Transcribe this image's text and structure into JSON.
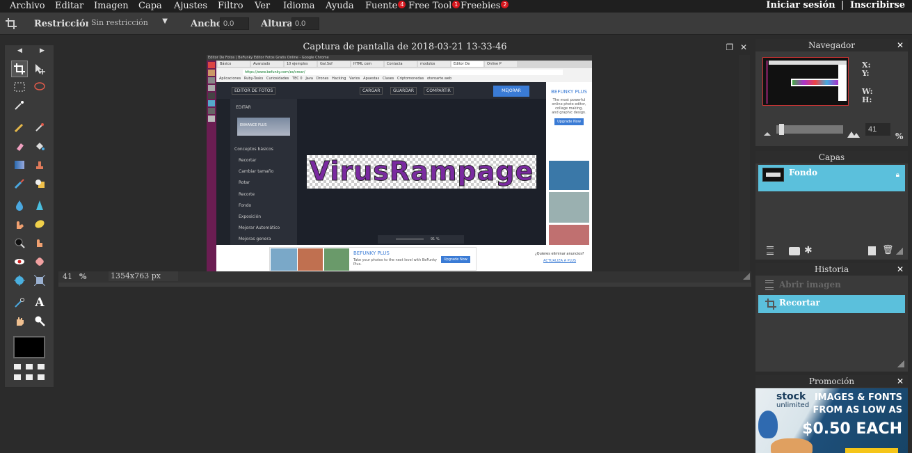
{
  "menubar": {
    "items": [
      "Archivo",
      "Editar",
      "Imagen",
      "Capa",
      "Ajustes",
      "Filtro",
      "Ver",
      "Idioma",
      "Ayuda"
    ],
    "extras": [
      {
        "label": "Fuente",
        "badge": "4"
      },
      {
        "label": "Free Tool",
        "badge": "1"
      },
      {
        "label": "Freebies",
        "badge": "2"
      }
    ],
    "login": "Iniciar sesión",
    "separator": "|",
    "signup": "Inscribirse"
  },
  "options": {
    "restriction_label": "Restricción:",
    "restriction_value": "Sin restricción",
    "width_label": "Ancho:",
    "width_value": "0.0",
    "height_label": "Altura:",
    "height_value": "0.0"
  },
  "document": {
    "title": "Captura de pantalla de 2018-03-21 13-33-46",
    "zoom": "41",
    "zoom_unit": "%",
    "dimensions": "1354x763 px",
    "inner": {
      "browser_title": "Editor De Fotos | BeFunky Editor Fotos Gratis Online - Google Chrome",
      "tabs": [
        "Básico",
        "Avanzado",
        "10 ejemplos",
        "Gal.Sof",
        "HTML com",
        "Contacta",
        "modulos",
        "Editor De",
        "Online P"
      ],
      "address": "https://www.befunky.com/es/crear/",
      "bookmarks": [
        "Aplicaciones",
        "Ruby-Tasks",
        "Curiosidades",
        "TEC 0",
        "Java",
        "Drones",
        "Hacking",
        "Varios",
        "Apuestas",
        "Clases",
        "Criptomonedas",
        "oteroarte.web"
      ],
      "editor_menu": "EDITOR DE FOTOS",
      "top_buttons": [
        "CARGAR",
        "GUARDAR",
        "COMPARTIR"
      ],
      "upgrade": "MEJORAR",
      "side_title": "EDITAR",
      "enhance": "ENHANCE PLUS",
      "section": "Conceptos básicos",
      "side_items": [
        "Recortar",
        "Cambiar tamaño",
        "Rotar",
        "Recorte",
        "Fondo",
        "Exposición",
        "Mejorar Automático",
        "Mejoras genera"
      ],
      "banner_text": "VirusRampage",
      "ad_title": "BEFUNKY PLUS",
      "ad_body": "The most powerful online photo editor, collage making, and graphic design.",
      "ad_button": "Upgrade Now",
      "bottom_ad_title": "BEFUNKY PLUS",
      "bottom_ad_body": "Take your photos to the next level with BeFunky Plus.",
      "bottom_ad_button": "Upgrade Now",
      "remove_ads": "¿Quieres eliminar anuncios?",
      "remove_ads_link": "ACTUALIZA A PLUS",
      "canvas_zoom": "91 %"
    }
  },
  "navigator": {
    "title": "Navegador",
    "x_label": "X:",
    "y_label": "Y:",
    "w_label": "W:",
    "h_label": "H:",
    "zoom": "41",
    "zoom_unit": "%"
  },
  "layers": {
    "title": "Capas",
    "items": [
      {
        "name": "Fondo"
      }
    ]
  },
  "history": {
    "title": "Historia",
    "items": [
      "Abrir imagen",
      "Recortar"
    ]
  },
  "promo": {
    "title": "Promoción",
    "brand": "stock",
    "brand_sub": "unlimited",
    "line1": "IMAGES & FONTS",
    "line2": "FROM AS LOW AS",
    "price": "$0.50 EACH"
  },
  "colors": {
    "accent": "#5bc0dc",
    "badge": "#d6161d",
    "inner_sidebar": "#6b1d52"
  }
}
